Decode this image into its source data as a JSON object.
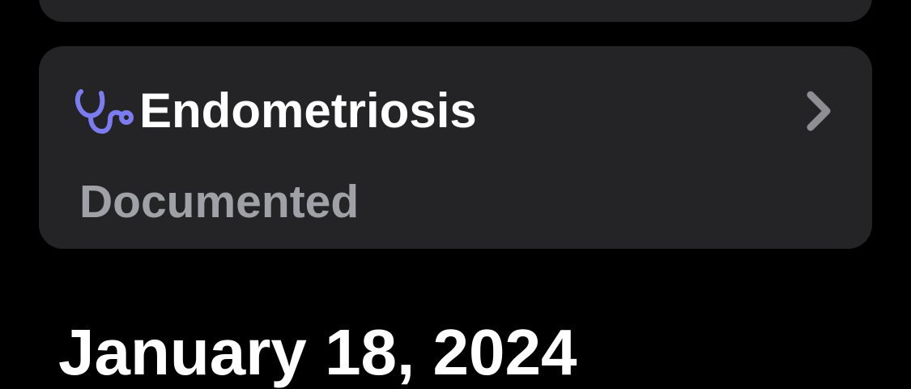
{
  "card": {
    "title": "Endometriosis",
    "status": "Documented",
    "icon": "stethoscope-icon",
    "icon_color": "#7b7cf0",
    "chevron_color": "#8e8e93"
  },
  "section": {
    "date": "January 18, 2024"
  },
  "colors": {
    "background": "#000000",
    "card": "#242426",
    "title_text": "#ffffff",
    "status_text": "#a0a0a7"
  }
}
